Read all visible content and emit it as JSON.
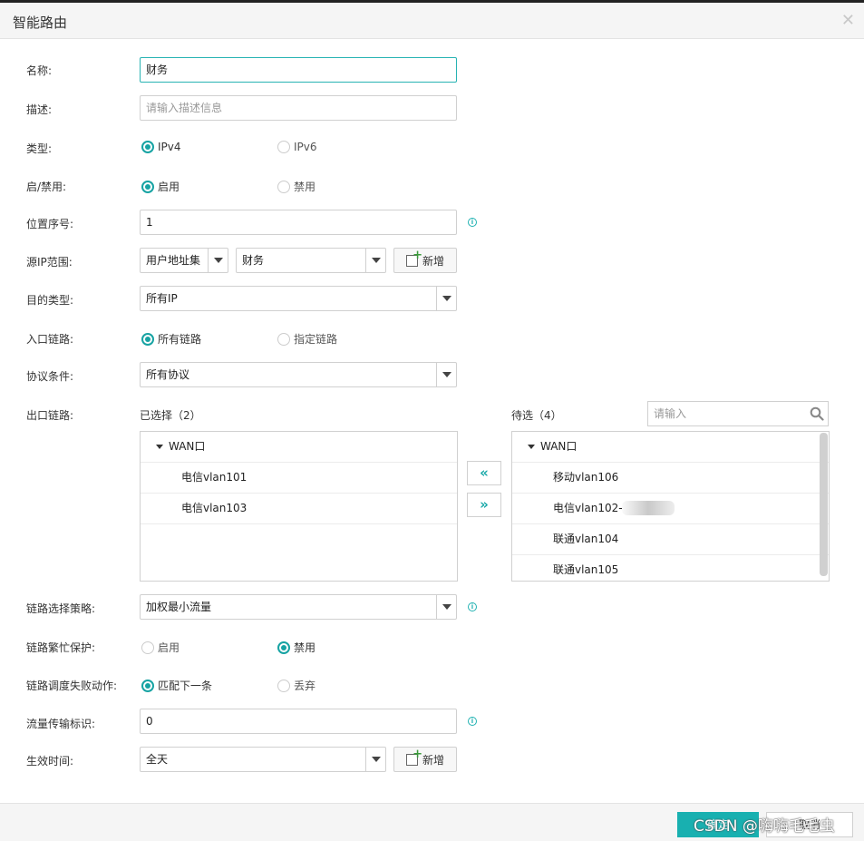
{
  "dialog": {
    "title": "智能路由"
  },
  "form": {
    "name": {
      "label": "名称:",
      "value": "财务"
    },
    "desc": {
      "label": "描述:",
      "placeholder": "请输入描述信息"
    },
    "type": {
      "label": "类型:",
      "options": [
        "IPv4",
        "IPv6"
      ],
      "selected": "IPv4"
    },
    "enable": {
      "label": "启/禁用:",
      "options": [
        "启用",
        "禁用"
      ],
      "selected": "启用"
    },
    "position": {
      "label": "位置序号:",
      "value": "1"
    },
    "src_ip": {
      "label": "源IP范围:",
      "type_value": "用户地址集",
      "value": "财务",
      "add_label": "新增"
    },
    "dst_type": {
      "label": "目的类型:",
      "value": "所有IP"
    },
    "in_link": {
      "label": "入口链路:",
      "options": [
        "所有链路",
        "指定链路"
      ],
      "selected": "所有链路"
    },
    "protocol": {
      "label": "协议条件:",
      "value": "所有协议"
    },
    "out_link": {
      "label": "出口链路:",
      "selected_title": "已选择（2）",
      "pending_title": "待选（4）",
      "search_placeholder": "请输入",
      "selected_group": "WAN口",
      "selected_items": [
        "电信vlan101",
        "电信vlan103"
      ],
      "pending_group": "WAN口",
      "pending_items": [
        "移动vlan106",
        "电信vlan102-",
        "联通vlan104",
        "联通vlan105"
      ],
      "move_left": "«",
      "move_right": "»"
    },
    "strategy": {
      "label": "链路选择策略:",
      "value": "加权最小流量"
    },
    "busy_protect": {
      "label": "链路繁忙保护:",
      "options": [
        "启用",
        "禁用"
      ],
      "selected": "禁用"
    },
    "fail_action": {
      "label": "链路调度失败动作:",
      "options": [
        "匹配下一条",
        "丢弃"
      ],
      "selected": "匹配下一条"
    },
    "flow_tag": {
      "label": "流量传输标识:",
      "value": "0"
    },
    "effective_time": {
      "label": "生效时间:",
      "value": "全天",
      "add_label": "新增"
    }
  },
  "footer": {
    "ok_label": "确定",
    "cancel_label": "取消"
  },
  "watermark": "CSDN @嗨嗨毛毛虫",
  "accent_color": "#18b0b0"
}
